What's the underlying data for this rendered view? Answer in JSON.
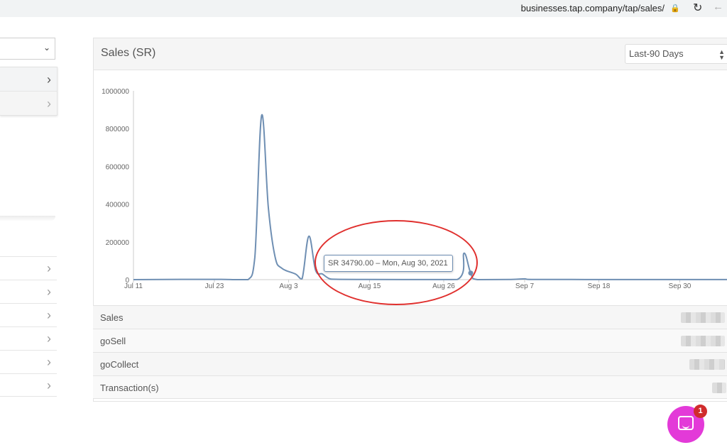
{
  "browser": {
    "url_host": "businesses.tap.company",
    "url_path": "/tap/sales/"
  },
  "panel": {
    "title": "Sales (SR)",
    "range_selected": "Last-90 Days"
  },
  "chart_data": {
    "type": "line",
    "title": "",
    "xlabel": "",
    "ylabel": "",
    "ylim": [
      0,
      1000000
    ],
    "y_ticks": [
      "1000000",
      "800000",
      "600000",
      "400000",
      "200000",
      "0"
    ],
    "x_ticks": [
      "Jul 11",
      "Jul 23",
      "Aug 3",
      "Aug 15",
      "Aug 26",
      "Sep 7",
      "Sep 18",
      "Sep 30"
    ],
    "x_tick_dates": [
      "2021-07-11",
      "2021-07-23",
      "2021-08-03",
      "2021-08-15",
      "2021-08-26",
      "2021-09-07",
      "2021-09-18",
      "2021-09-30"
    ],
    "x_range": [
      "2021-07-11",
      "2021-10-07"
    ],
    "grid": false,
    "series": [
      {
        "color": "#6f8fb3",
        "points": [
          [
            "2021-07-11",
            0
          ],
          [
            "2021-07-19",
            1500
          ],
          [
            "2021-07-24",
            1500
          ],
          [
            "2021-07-26",
            0
          ],
          [
            "2021-07-28",
            0
          ],
          [
            "2021-07-29",
            120000
          ],
          [
            "2021-07-30",
            870000
          ],
          [
            "2021-07-31",
            380000
          ],
          [
            "2021-08-01",
            120000
          ],
          [
            "2021-08-02",
            60000
          ],
          [
            "2021-08-04",
            30000
          ],
          [
            "2021-08-05",
            5000
          ],
          [
            "2021-08-06",
            230000
          ],
          [
            "2021-08-07",
            50000
          ],
          [
            "2021-08-08",
            30000
          ],
          [
            "2021-08-09",
            6000
          ],
          [
            "2021-08-10",
            2000
          ],
          [
            "2021-08-14",
            1000
          ],
          [
            "2021-08-20",
            500
          ],
          [
            "2021-08-28",
            800
          ],
          [
            "2021-08-29",
            140000
          ],
          [
            "2021-08-30",
            34790
          ],
          [
            "2021-08-31",
            0
          ],
          [
            "2021-09-05",
            1000
          ],
          [
            "2021-09-07",
            4000
          ],
          [
            "2021-09-08",
            1000
          ],
          [
            "2021-09-14",
            800
          ],
          [
            "2021-09-22",
            500
          ],
          [
            "2021-10-07",
            500
          ]
        ]
      }
    ],
    "tooltip": "SR 34790.00 – Mon, Aug 30, 2021",
    "tooltip_point": [
      "2021-08-30",
      34790
    ]
  },
  "summary_rows": [
    {
      "label": "Sales"
    },
    {
      "label": "goSell"
    },
    {
      "label": "goCollect"
    },
    {
      "label": "Transaction(s)"
    }
  ],
  "chat": {
    "badge_count": "1"
  }
}
